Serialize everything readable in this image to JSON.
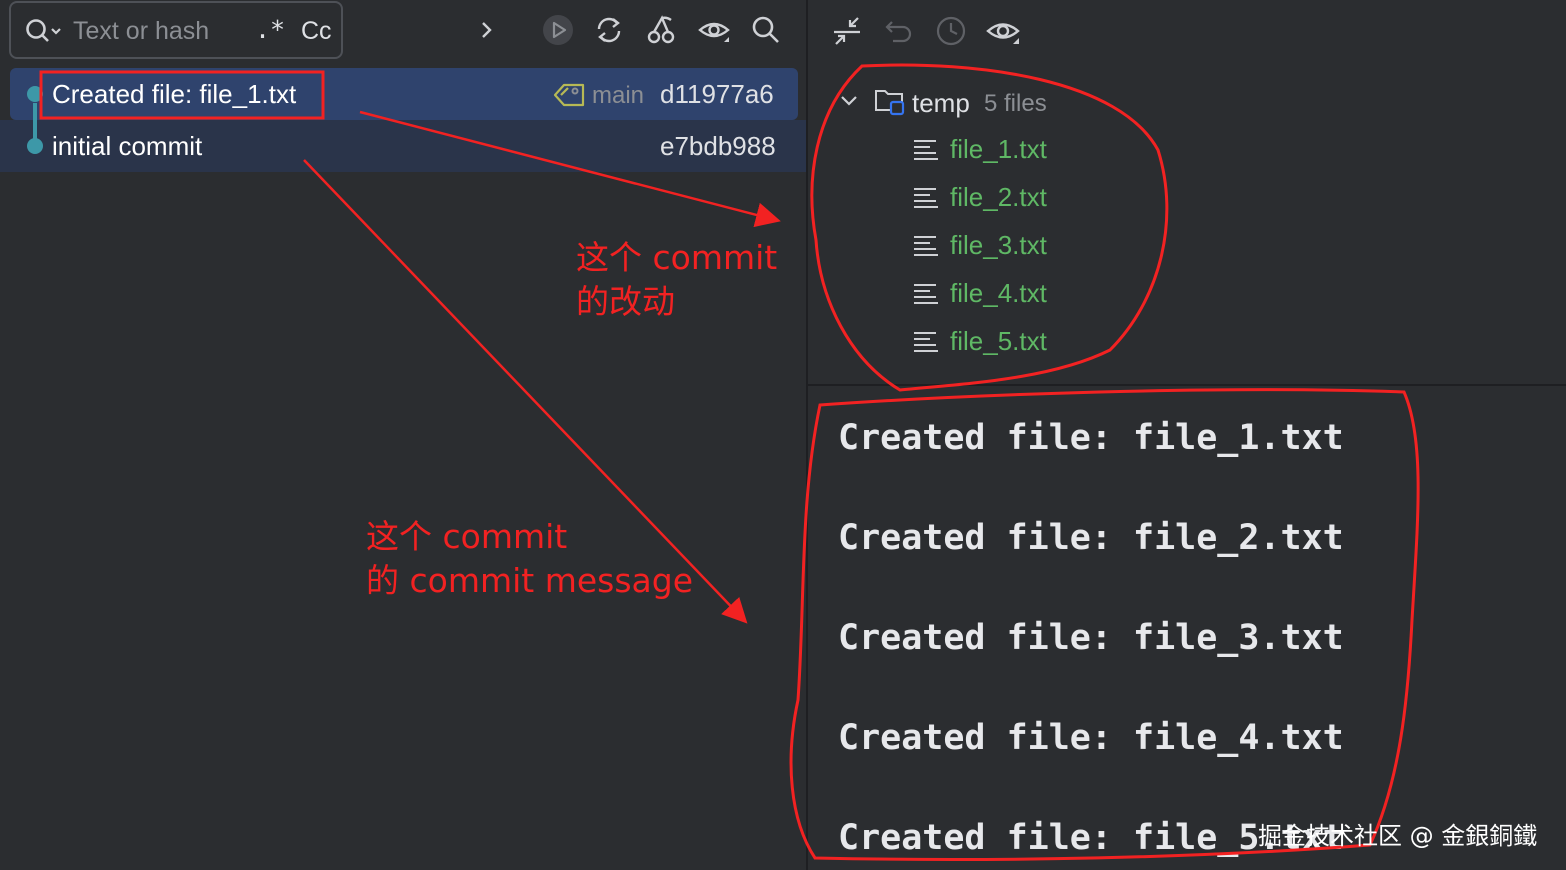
{
  "toolbar": {
    "search_placeholder": "Text or hash",
    "regex_label": ".*",
    "case_label": "Cc"
  },
  "commits": [
    {
      "message": "Created file: file_1.txt",
      "branch": "main",
      "hash": "d11977a6",
      "selected": true
    },
    {
      "message": "initial commit",
      "branch": "",
      "hash": "e7bdb988",
      "selected": false
    }
  ],
  "changes": {
    "folder": "temp",
    "count_label": "5 files",
    "files": [
      "file_1.txt",
      "file_2.txt",
      "file_3.txt",
      "file_4.txt",
      "file_5.txt"
    ]
  },
  "commit_message_lines": [
    "Created file: file_1.txt",
    "Created file: file_2.txt",
    "Created file: file_3.txt",
    "Created file: file_4.txt",
    "Created file: file_5.txt"
  ],
  "annotations": {
    "changes_note_line1": "这个 commit",
    "changes_note_line2": "的改动",
    "message_note_line1": "这个 commit",
    "message_note_line2": "的 commit message",
    "color": "#f22222"
  },
  "watermark": "掘金技术社区 @ 金銀銅鐵",
  "colors": {
    "background": "#2b2d30",
    "selected_row": "#2f436d",
    "graph": "#3d98a8",
    "added_file": "#5fb865"
  }
}
